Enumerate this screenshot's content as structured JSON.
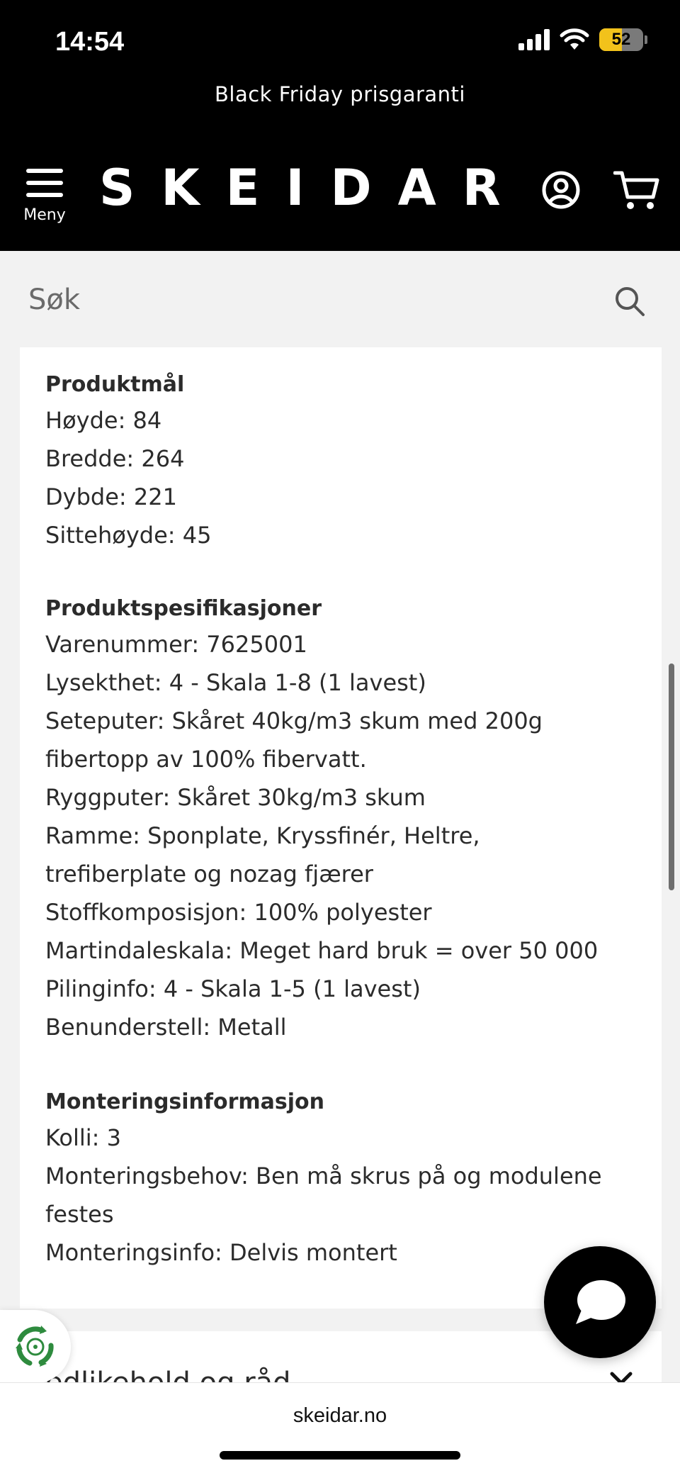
{
  "status_bar": {
    "time": "14:54",
    "battery": "52",
    "battery_level": 0.52
  },
  "header": {
    "promo": "Black Friday prisgaranti",
    "menu_label": "Meny",
    "logo": "SKEIDAR"
  },
  "search": {
    "placeholder": "Søk"
  },
  "product": {
    "dimensions": {
      "title": "Produktmål",
      "lines": [
        "Høyde: 84",
        "Bredde: 264",
        "Dybde: 221",
        "Sittehøyde: 45"
      ]
    },
    "specs": {
      "title": "Produktspesifikasjoner",
      "lines": [
        "Varenummer: 7625001",
        "Lysekthet: 4 - Skala 1-8 (1 lavest)",
        "Seteputer: Skåret 40kg/m3 skum med 200g",
        "fibertopp av 100% fibervatt.",
        "Ryggputer: Skåret 30kg/m3 skum",
        "Ramme: Sponplate, Kryssfinér, Heltre,",
        "trefiberplate og nozag fjærer",
        "Stoffkomposisjon: 100% polyester",
        "Martindaleskala: Meget hard bruk = over 50 000",
        "Pilinginfo: 4 - Skala 1-5 (1 lavest)",
        "Benunderstell: Metall"
      ]
    },
    "assembly": {
      "title": "Monteringsinformasjon",
      "lines": [
        "Kolli: 3",
        "Monteringsbehov: Ben må skrus på og modulene",
        "festes",
        "Monteringsinfo: Delvis montert"
      ]
    }
  },
  "accordion": {
    "partial_title": "edlikehold og råd"
  },
  "browser": {
    "url": "skeidar.no"
  },
  "colors": {
    "header_bg": "#000000",
    "battery": "#f2c21b",
    "eco_green": "#2e8b3e"
  }
}
